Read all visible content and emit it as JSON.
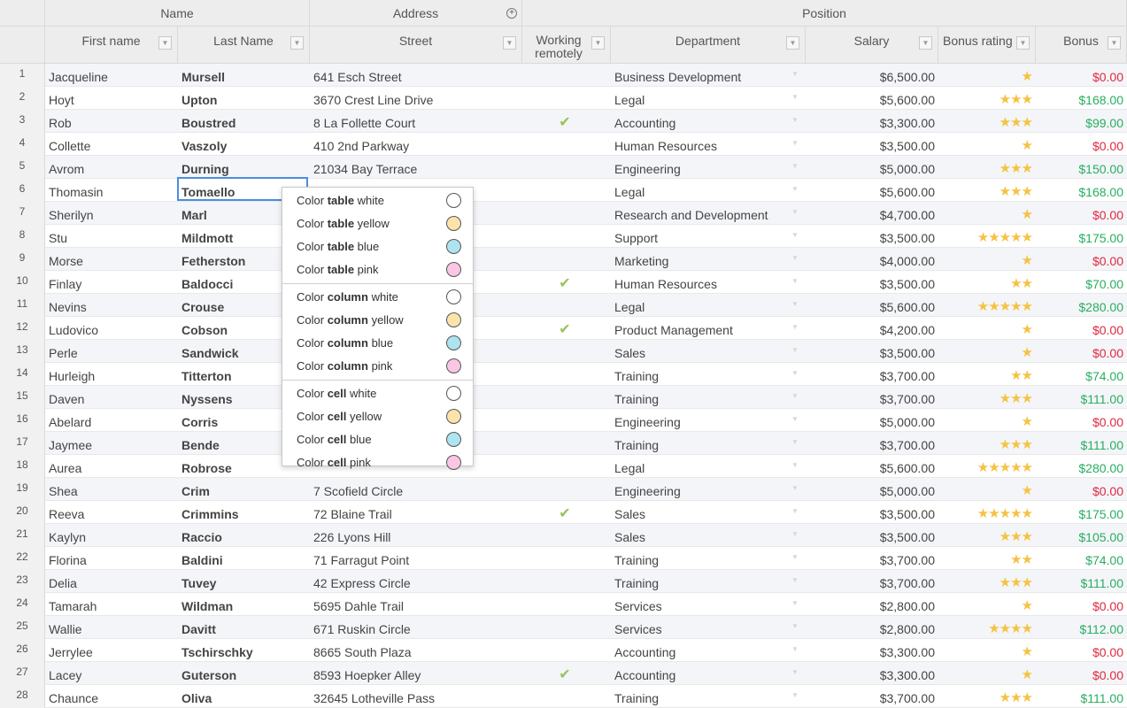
{
  "header": {
    "groups": {
      "name": "Name",
      "address": "Address",
      "position": "Position"
    },
    "columns": {
      "first_name": "First name",
      "last_name": "Last Name",
      "street": "Street",
      "working_remotely": "Working remotely",
      "department": "Department",
      "salary": "Salary",
      "bonus_rating": "Bonus rating",
      "bonus": "Bonus"
    },
    "filter_icon": "filter-icon",
    "expand_icon": "plus-circle-icon"
  },
  "rows": [
    {
      "n": "1",
      "first": "Jacqueline",
      "last": "Mursell",
      "street": "641 Esch Street",
      "remote": false,
      "dept": "Business Development",
      "salary": "$6,500.00",
      "stars": 1,
      "bonus": "$0.00"
    },
    {
      "n": "2",
      "first": "Hoyt",
      "last": "Upton",
      "street": "3670 Crest Line Drive",
      "remote": false,
      "dept": "Legal",
      "salary": "$5,600.00",
      "stars": 3,
      "bonus": "$168.00"
    },
    {
      "n": "3",
      "first": "Rob",
      "last": "Boustred",
      "street": "8 La Follette Court",
      "remote": true,
      "dept": "Accounting",
      "salary": "$3,300.00",
      "stars": 3,
      "bonus": "$99.00"
    },
    {
      "n": "4",
      "first": "Collette",
      "last": "Vaszoly",
      "street": "410 2nd Parkway",
      "remote": false,
      "dept": "Human Resources",
      "salary": "$3,500.00",
      "stars": 1,
      "bonus": "$0.00"
    },
    {
      "n": "5",
      "first": "Avrom",
      "last": "Durning",
      "street": "21034 Bay Terrace",
      "remote": false,
      "dept": "Engineering",
      "salary": "$5,000.00",
      "stars": 3,
      "bonus": "$150.00"
    },
    {
      "n": "6",
      "first": "Thomasin",
      "last": "Tomaello",
      "street": "",
      "remote": false,
      "dept": "Legal",
      "salary": "$5,600.00",
      "stars": 3,
      "bonus": "$168.00"
    },
    {
      "n": "7",
      "first": "Sherilyn",
      "last": "Marl",
      "street": "",
      "remote": false,
      "dept": "Research and Development",
      "salary": "$4,700.00",
      "stars": 1,
      "bonus": "$0.00"
    },
    {
      "n": "8",
      "first": "Stu",
      "last": "Mildmott",
      "street": "",
      "remote": false,
      "dept": "Support",
      "salary": "$3,500.00",
      "stars": 5,
      "bonus": "$175.00"
    },
    {
      "n": "9",
      "first": "Morse",
      "last": "Fetherston",
      "street": "",
      "remote": false,
      "dept": "Marketing",
      "salary": "$4,000.00",
      "stars": 1,
      "bonus": "$0.00"
    },
    {
      "n": "10",
      "first": "Finlay",
      "last": "Baldocci",
      "street": "",
      "remote": true,
      "dept": "Human Resources",
      "salary": "$3,500.00",
      "stars": 2,
      "bonus": "$70.00"
    },
    {
      "n": "11",
      "first": "Nevins",
      "last": "Crouse",
      "street": "",
      "remote": false,
      "dept": "Legal",
      "salary": "$5,600.00",
      "stars": 5,
      "bonus": "$280.00"
    },
    {
      "n": "12",
      "first": "Ludovico",
      "last": "Cobson",
      "street": "",
      "remote": true,
      "dept": "Product Management",
      "salary": "$4,200.00",
      "stars": 1,
      "bonus": "$0.00"
    },
    {
      "n": "13",
      "first": "Perle",
      "last": "Sandwick",
      "street": "",
      "remote": false,
      "dept": "Sales",
      "salary": "$3,500.00",
      "stars": 1,
      "bonus": "$0.00"
    },
    {
      "n": "14",
      "first": "Hurleigh",
      "last": "Titterton",
      "street": "",
      "remote": false,
      "dept": "Training",
      "salary": "$3,700.00",
      "stars": 2,
      "bonus": "$74.00"
    },
    {
      "n": "15",
      "first": "Daven",
      "last": "Nyssens",
      "street": "",
      "remote": false,
      "dept": "Training",
      "salary": "$3,700.00",
      "stars": 3,
      "bonus": "$111.00"
    },
    {
      "n": "16",
      "first": "Abelard",
      "last": "Corris",
      "street": "",
      "remote": false,
      "dept": "Engineering",
      "salary": "$5,000.00",
      "stars": 1,
      "bonus": "$0.00"
    },
    {
      "n": "17",
      "first": "Jaymee",
      "last": "Bende",
      "street": "",
      "remote": false,
      "dept": "Training",
      "salary": "$3,700.00",
      "stars": 3,
      "bonus": "$111.00"
    },
    {
      "n": "18",
      "first": "Aurea",
      "last": "Robrose",
      "street": "",
      "remote": false,
      "dept": "Legal",
      "salary": "$5,600.00",
      "stars": 5,
      "bonus": "$280.00"
    },
    {
      "n": "19",
      "first": "Shea",
      "last": "Crim",
      "street": "7 Scofield Circle",
      "remote": false,
      "dept": "Engineering",
      "salary": "$5,000.00",
      "stars": 1,
      "bonus": "$0.00"
    },
    {
      "n": "20",
      "first": "Reeva",
      "last": "Crimmins",
      "street": "72 Blaine Trail",
      "remote": true,
      "dept": "Sales",
      "salary": "$3,500.00",
      "stars": 5,
      "bonus": "$175.00"
    },
    {
      "n": "21",
      "first": "Kaylyn",
      "last": "Raccio",
      "street": "226 Lyons Hill",
      "remote": false,
      "dept": "Sales",
      "salary": "$3,500.00",
      "stars": 3,
      "bonus": "$105.00"
    },
    {
      "n": "22",
      "first": "Florina",
      "last": "Baldini",
      "street": "71 Farragut Point",
      "remote": false,
      "dept": "Training",
      "salary": "$3,700.00",
      "stars": 2,
      "bonus": "$74.00"
    },
    {
      "n": "23",
      "first": "Delia",
      "last": "Tuvey",
      "street": "42 Express Circle",
      "remote": false,
      "dept": "Training",
      "salary": "$3,700.00",
      "stars": 3,
      "bonus": "$111.00"
    },
    {
      "n": "24",
      "first": "Tamarah",
      "last": "Wildman",
      "street": "5695 Dahle Trail",
      "remote": false,
      "dept": "Services",
      "salary": "$2,800.00",
      "stars": 1,
      "bonus": "$0.00"
    },
    {
      "n": "25",
      "first": "Wallie",
      "last": "Davitt",
      "street": "671 Ruskin Circle",
      "remote": false,
      "dept": "Services",
      "salary": "$2,800.00",
      "stars": 4,
      "bonus": "$112.00"
    },
    {
      "n": "26",
      "first": "Jerrylee",
      "last": "Tschirschky",
      "street": "8665 South Plaza",
      "remote": false,
      "dept": "Accounting",
      "salary": "$3,300.00",
      "stars": 1,
      "bonus": "$0.00"
    },
    {
      "n": "27",
      "first": "Lacey",
      "last": "Guterson",
      "street": "8593 Hoepker Alley",
      "remote": true,
      "dept": "Accounting",
      "salary": "$3,300.00",
      "stars": 1,
      "bonus": "$0.00"
    },
    {
      "n": "28",
      "first": "Chaunce",
      "last": "Oliva",
      "street": "32645 Lotheville Pass",
      "remote": false,
      "dept": "Training",
      "salary": "$3,700.00",
      "stars": 3,
      "bonus": "$111.00"
    }
  ],
  "context_menu": {
    "groups": [
      {
        "target": "table",
        "items": [
          {
            "prefix": "Color",
            "bold": "table",
            "suffix": "white",
            "color": "#ffffff"
          },
          {
            "prefix": "Color",
            "bold": "table",
            "suffix": "yellow",
            "color": "#fbe3aa"
          },
          {
            "prefix": "Color",
            "bold": "table",
            "suffix": "blue",
            "color": "#aee3f2"
          },
          {
            "prefix": "Color",
            "bold": "table",
            "suffix": "pink",
            "color": "#f9c6e3"
          }
        ]
      },
      {
        "target": "column",
        "items": [
          {
            "prefix": "Color",
            "bold": "column",
            "suffix": "white",
            "color": "#ffffff"
          },
          {
            "prefix": "Color",
            "bold": "column",
            "suffix": "yellow",
            "color": "#fbe3aa"
          },
          {
            "prefix": "Color",
            "bold": "column",
            "suffix": "blue",
            "color": "#aee3f2"
          },
          {
            "prefix": "Color",
            "bold": "column",
            "suffix": "pink",
            "color": "#f9c6e3"
          }
        ]
      },
      {
        "target": "cell",
        "items": [
          {
            "prefix": "Color",
            "bold": "cell",
            "suffix": "white",
            "color": "#ffffff"
          },
          {
            "prefix": "Color",
            "bold": "cell",
            "suffix": "yellow",
            "color": "#fbe3aa"
          },
          {
            "prefix": "Color",
            "bold": "cell",
            "suffix": "blue",
            "color": "#aee3f2"
          },
          {
            "prefix": "Color",
            "bold": "cell",
            "suffix": "pink",
            "color": "#f9c6e3"
          }
        ]
      }
    ]
  },
  "colors": {
    "positive_bonus": "#27ae60",
    "zero_bonus": "#e0283f",
    "star": "#f5c242",
    "check": "#9ac25a",
    "selection": "#4c8de0"
  }
}
